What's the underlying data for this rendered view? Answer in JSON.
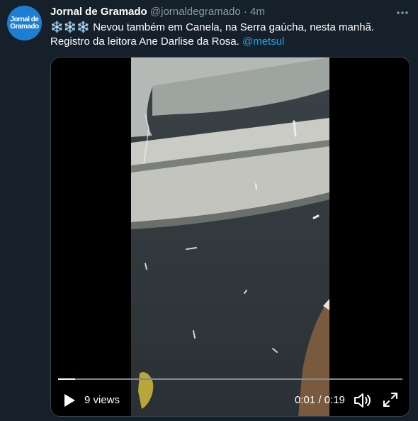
{
  "account": {
    "avatar_text_line1": "Jornal de",
    "avatar_text_line2": "Gramado",
    "name": "Jornal de Gramado",
    "handle": "@jornaldegramado",
    "separator": "·",
    "time": "4m"
  },
  "tweet": {
    "emoji": "❄️❄️❄️",
    "text_part1": " Nevou também em Canela, na Serra gaúcha, nesta manhã.",
    "text_part2": "Registro da leitora Ane Darlise da Rosa. ",
    "mention": "@metsul"
  },
  "video": {
    "views": "9 views",
    "time_display": "0:01 / 0:19",
    "progress": 0.05
  },
  "icons": {
    "more": "more-icon",
    "play": "play-icon",
    "volume": "volume-icon",
    "fullscreen": "fullscreen-icon"
  }
}
